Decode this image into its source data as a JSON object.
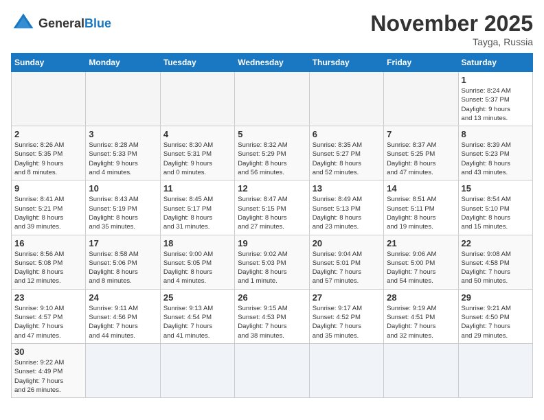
{
  "header": {
    "logo_general": "General",
    "logo_blue": "Blue",
    "month_title": "November 2025",
    "location": "Tayga, Russia"
  },
  "weekdays": [
    "Sunday",
    "Monday",
    "Tuesday",
    "Wednesday",
    "Thursday",
    "Friday",
    "Saturday"
  ],
  "weeks": [
    [
      {
        "day": "",
        "info": ""
      },
      {
        "day": "",
        "info": ""
      },
      {
        "day": "",
        "info": ""
      },
      {
        "day": "",
        "info": ""
      },
      {
        "day": "",
        "info": ""
      },
      {
        "day": "",
        "info": ""
      },
      {
        "day": "1",
        "info": "Sunrise: 8:24 AM\nSunset: 5:37 PM\nDaylight: 9 hours\nand 13 minutes."
      }
    ],
    [
      {
        "day": "2",
        "info": "Sunrise: 8:26 AM\nSunset: 5:35 PM\nDaylight: 9 hours\nand 8 minutes."
      },
      {
        "day": "3",
        "info": "Sunrise: 8:28 AM\nSunset: 5:33 PM\nDaylight: 9 hours\nand 4 minutes."
      },
      {
        "day": "4",
        "info": "Sunrise: 8:30 AM\nSunset: 5:31 PM\nDaylight: 9 hours\nand 0 minutes."
      },
      {
        "day": "5",
        "info": "Sunrise: 8:32 AM\nSunset: 5:29 PM\nDaylight: 8 hours\nand 56 minutes."
      },
      {
        "day": "6",
        "info": "Sunrise: 8:35 AM\nSunset: 5:27 PM\nDaylight: 8 hours\nand 52 minutes."
      },
      {
        "day": "7",
        "info": "Sunrise: 8:37 AM\nSunset: 5:25 PM\nDaylight: 8 hours\nand 47 minutes."
      },
      {
        "day": "8",
        "info": "Sunrise: 8:39 AM\nSunset: 5:23 PM\nDaylight: 8 hours\nand 43 minutes."
      }
    ],
    [
      {
        "day": "9",
        "info": "Sunrise: 8:41 AM\nSunset: 5:21 PM\nDaylight: 8 hours\nand 39 minutes."
      },
      {
        "day": "10",
        "info": "Sunrise: 8:43 AM\nSunset: 5:19 PM\nDaylight: 8 hours\nand 35 minutes."
      },
      {
        "day": "11",
        "info": "Sunrise: 8:45 AM\nSunset: 5:17 PM\nDaylight: 8 hours\nand 31 minutes."
      },
      {
        "day": "12",
        "info": "Sunrise: 8:47 AM\nSunset: 5:15 PM\nDaylight: 8 hours\nand 27 minutes."
      },
      {
        "day": "13",
        "info": "Sunrise: 8:49 AM\nSunset: 5:13 PM\nDaylight: 8 hours\nand 23 minutes."
      },
      {
        "day": "14",
        "info": "Sunrise: 8:51 AM\nSunset: 5:11 PM\nDaylight: 8 hours\nand 19 minutes."
      },
      {
        "day": "15",
        "info": "Sunrise: 8:54 AM\nSunset: 5:10 PM\nDaylight: 8 hours\nand 15 minutes."
      }
    ],
    [
      {
        "day": "16",
        "info": "Sunrise: 8:56 AM\nSunset: 5:08 PM\nDaylight: 8 hours\nand 12 minutes."
      },
      {
        "day": "17",
        "info": "Sunrise: 8:58 AM\nSunset: 5:06 PM\nDaylight: 8 hours\nand 8 minutes."
      },
      {
        "day": "18",
        "info": "Sunrise: 9:00 AM\nSunset: 5:05 PM\nDaylight: 8 hours\nand 4 minutes."
      },
      {
        "day": "19",
        "info": "Sunrise: 9:02 AM\nSunset: 5:03 PM\nDaylight: 8 hours\nand 1 minute."
      },
      {
        "day": "20",
        "info": "Sunrise: 9:04 AM\nSunset: 5:01 PM\nDaylight: 7 hours\nand 57 minutes."
      },
      {
        "day": "21",
        "info": "Sunrise: 9:06 AM\nSunset: 5:00 PM\nDaylight: 7 hours\nand 54 minutes."
      },
      {
        "day": "22",
        "info": "Sunrise: 9:08 AM\nSunset: 4:58 PM\nDaylight: 7 hours\nand 50 minutes."
      }
    ],
    [
      {
        "day": "23",
        "info": "Sunrise: 9:10 AM\nSunset: 4:57 PM\nDaylight: 7 hours\nand 47 minutes."
      },
      {
        "day": "24",
        "info": "Sunrise: 9:11 AM\nSunset: 4:56 PM\nDaylight: 7 hours\nand 44 minutes."
      },
      {
        "day": "25",
        "info": "Sunrise: 9:13 AM\nSunset: 4:54 PM\nDaylight: 7 hours\nand 41 minutes."
      },
      {
        "day": "26",
        "info": "Sunrise: 9:15 AM\nSunset: 4:53 PM\nDaylight: 7 hours\nand 38 minutes."
      },
      {
        "day": "27",
        "info": "Sunrise: 9:17 AM\nSunset: 4:52 PM\nDaylight: 7 hours\nand 35 minutes."
      },
      {
        "day": "28",
        "info": "Sunrise: 9:19 AM\nSunset: 4:51 PM\nDaylight: 7 hours\nand 32 minutes."
      },
      {
        "day": "29",
        "info": "Sunrise: 9:21 AM\nSunset: 4:50 PM\nDaylight: 7 hours\nand 29 minutes."
      }
    ],
    [
      {
        "day": "30",
        "info": "Sunrise: 9:22 AM\nSunset: 4:49 PM\nDaylight: 7 hours\nand 26 minutes."
      },
      {
        "day": "",
        "info": ""
      },
      {
        "day": "",
        "info": ""
      },
      {
        "day": "",
        "info": ""
      },
      {
        "day": "",
        "info": ""
      },
      {
        "day": "",
        "info": ""
      },
      {
        "day": "",
        "info": ""
      }
    ]
  ]
}
